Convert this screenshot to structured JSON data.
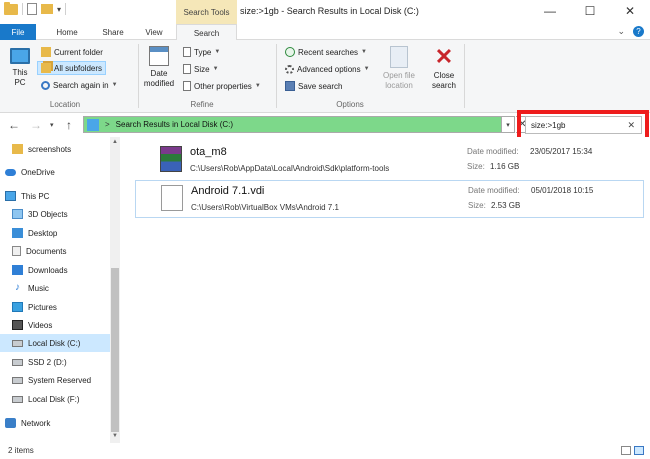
{
  "window": {
    "title": "size:>1gb - Search Results in Local Disk (C:)",
    "contextual_tab": "Search Tools",
    "minimize": "—",
    "maximize": "☐",
    "close": "✕"
  },
  "menu": {
    "tabs": [
      "File",
      "Home",
      "Share",
      "View",
      "Search"
    ],
    "active_tab": "Search",
    "collapse_glyph": "⌄",
    "help_glyph": "?"
  },
  "ribbon": {
    "location": {
      "label": "Location",
      "this_pc": "This PC",
      "current_folder": "Current folder",
      "all_subfolders": "All subfolders",
      "search_again_in": "Search again in"
    },
    "refine": {
      "label": "Refine",
      "date_modified": "Date modified",
      "type": "Type",
      "size": "Size",
      "other_properties": "Other properties"
    },
    "options": {
      "label": "Options",
      "recent_searches": "Recent searches",
      "advanced_options": "Advanced options",
      "save_search": "Save search",
      "open_file_location": "Open file location",
      "close_search": "Close search"
    }
  },
  "address": {
    "path": "Search Results in Local Disk (C:)",
    "separator": ">"
  },
  "search": {
    "value": "size:>1gb",
    "clear_glyph": "✕"
  },
  "sidebar": {
    "items": [
      {
        "label": "screenshots",
        "icon": "folder-icon"
      },
      {
        "label": "OneDrive",
        "icon": "cloud-icon"
      },
      {
        "label": "This PC",
        "icon": "pc-icon"
      },
      {
        "label": "3D Objects",
        "icon": "3d-objects-icon"
      },
      {
        "label": "Desktop",
        "icon": "desktop-icon"
      },
      {
        "label": "Documents",
        "icon": "documents-icon"
      },
      {
        "label": "Downloads",
        "icon": "downloads-icon"
      },
      {
        "label": "Music",
        "icon": "music-icon"
      },
      {
        "label": "Pictures",
        "icon": "pictures-icon"
      },
      {
        "label": "Videos",
        "icon": "videos-icon"
      },
      {
        "label": "Local Disk (C:)",
        "icon": "drive-icon"
      },
      {
        "label": "SSD 2 (D:)",
        "icon": "drive-icon"
      },
      {
        "label": "System Reserved",
        "icon": "drive-icon"
      },
      {
        "label": "Local Disk (F:)",
        "icon": "drive-icon"
      },
      {
        "label": "Network",
        "icon": "network-icon"
      }
    ],
    "selected": "Local Disk (C:)"
  },
  "results": {
    "date_label": "Date modified:",
    "size_label": "Size:",
    "items": [
      {
        "name": "ota_m8",
        "path": "C:\\Users\\Rob\\AppData\\Local\\Android\\Sdk\\platform-tools",
        "date_modified": "23/05/2017 15:34",
        "size": "1.16 GB",
        "icon": "winrar-archive-icon"
      },
      {
        "name": "Android 7.1.vdi",
        "path": "C:\\Users\\Rob\\VirtualBox VMs\\Android 7.1",
        "date_modified": "05/01/2018 10:15",
        "size": "2.53 GB",
        "icon": "blank-file-icon"
      }
    ]
  },
  "status": {
    "item_count": "2 items"
  },
  "colors": {
    "file_tab": "#1979ca",
    "search_tools_tab": "#f5e7b8",
    "address_bar": "#7dd88a",
    "highlight_box": "#ee1c1c",
    "selection": "#cce8ff"
  }
}
